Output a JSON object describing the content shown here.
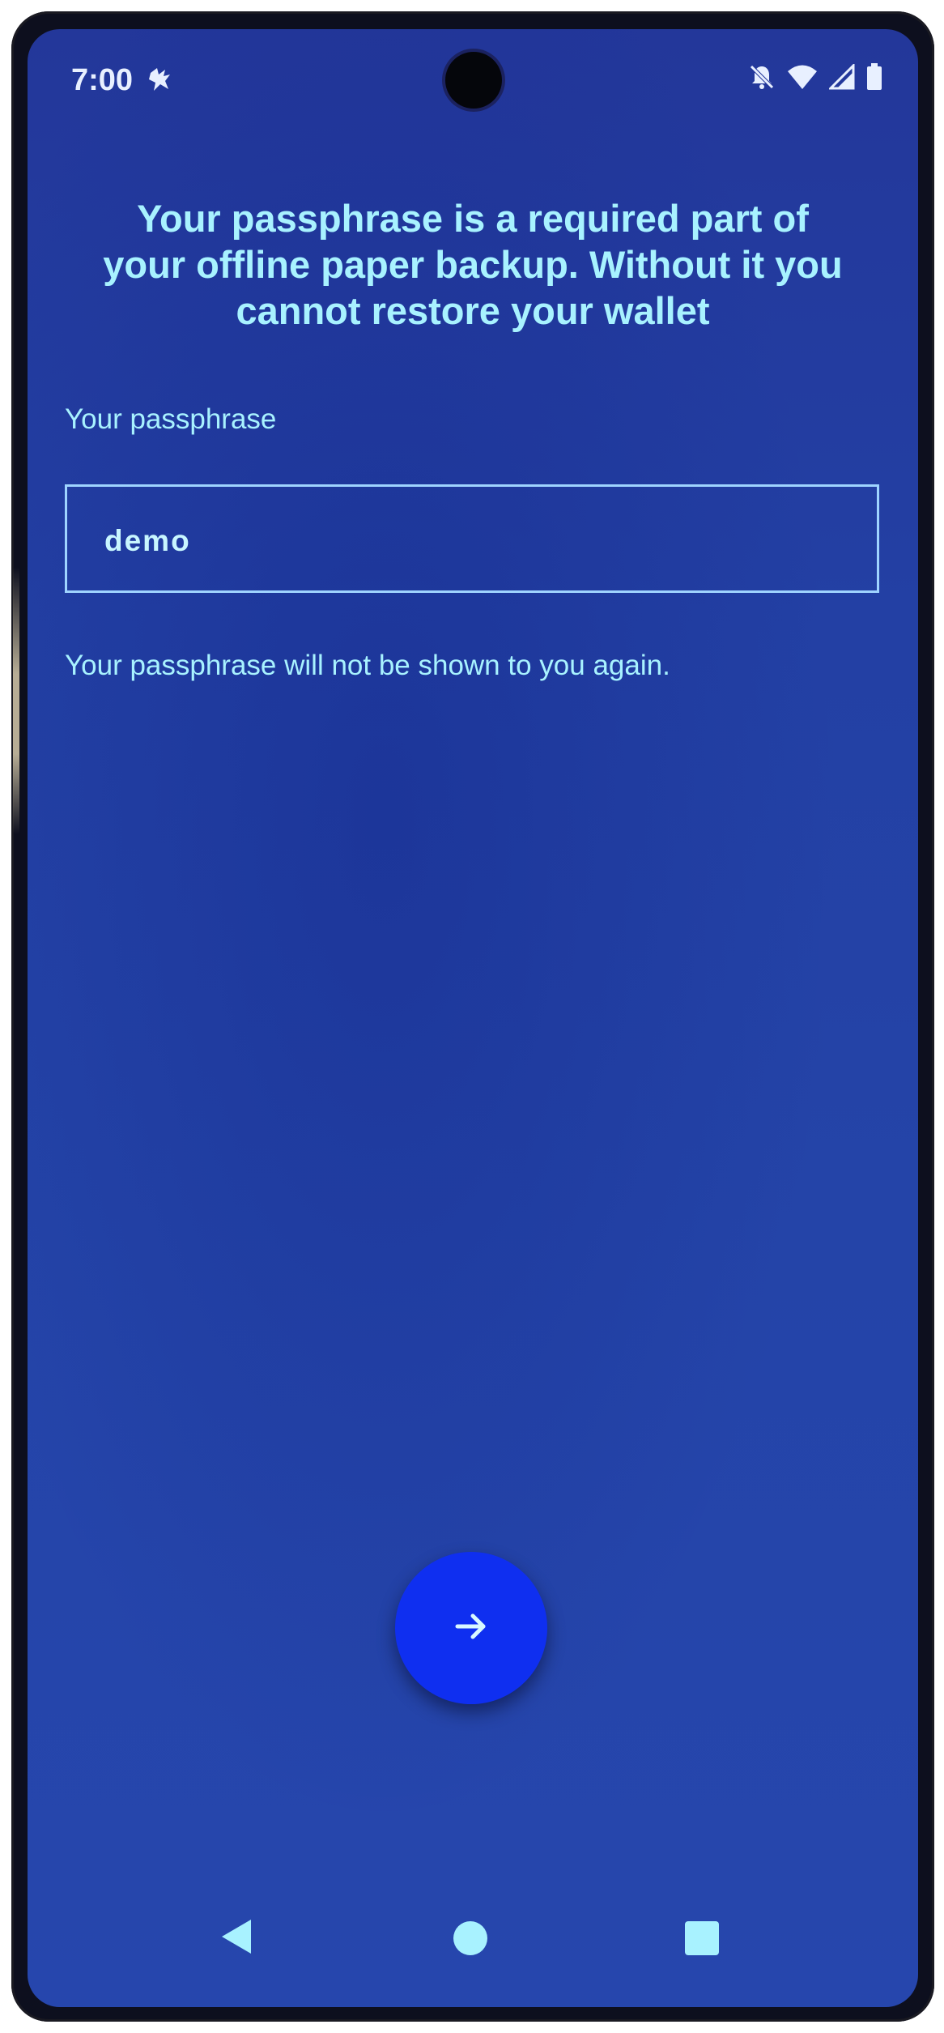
{
  "status_bar": {
    "time": "7:00",
    "icons": [
      "notification-app-icon",
      "bell-off-icon",
      "wifi-icon",
      "signal-icon",
      "battery-icon"
    ]
  },
  "screen": {
    "headline": "Your passphrase is a required part of your offline paper backup. Without it you cannot restore your wallet",
    "field_label": "Your passphrase",
    "field_value": "demo",
    "helper_text": "Your passphrase will not be shown to you again."
  },
  "fab": {
    "icon": "arrow-right-icon"
  },
  "nav_bar": {
    "buttons": [
      "back-icon",
      "home-icon",
      "recents-icon"
    ]
  },
  "colors": {
    "background": "#2340a4",
    "text": "#a8f2ff",
    "field_border": "#9fd4ff",
    "fab": "#0f2ff0"
  }
}
